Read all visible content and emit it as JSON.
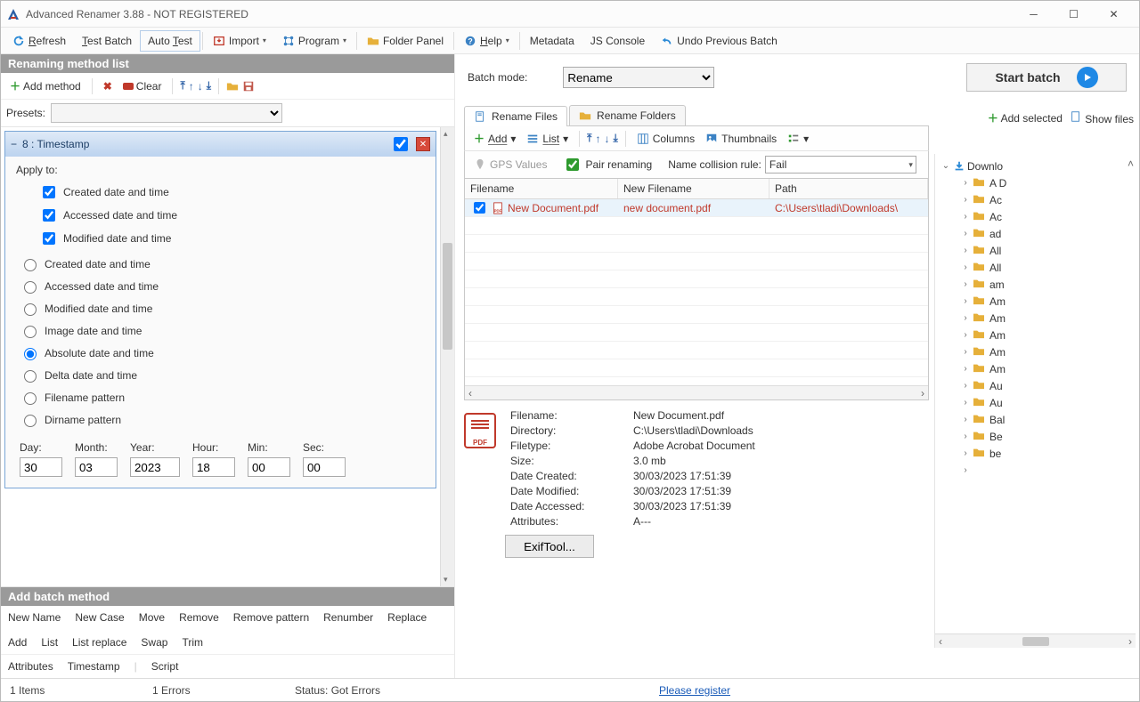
{
  "window": {
    "title": "Advanced Renamer 3.88 - NOT REGISTERED"
  },
  "toolbar": {
    "refresh": "Refresh",
    "test_batch": "Test Batch",
    "auto_test": "Auto Test",
    "import": "Import",
    "program": "Program",
    "folder_panel": "Folder Panel",
    "help": "Help",
    "metadata": "Metadata",
    "js_console": "JS Console",
    "undo": "Undo Previous Batch"
  },
  "left": {
    "header": "Renaming method list",
    "add_method": "Add method",
    "clear": "Clear",
    "presets_label": "Presets:",
    "timestamp_title": "8 : Timestamp",
    "apply_to": "Apply to:",
    "cb_created": "Created date and time",
    "cb_accessed": "Accessed date and time",
    "cb_modified": "Modified date and time",
    "rb_created": "Created date and time",
    "rb_accessed": "Accessed date and time",
    "rb_modified": "Modified date and time",
    "rb_image": "Image date and time",
    "rb_absolute": "Absolute date and time",
    "rb_delta": "Delta date and time",
    "rb_filename": "Filename pattern",
    "rb_dirname": "Dirname pattern",
    "dt": {
      "day_l": "Day:",
      "month_l": "Month:",
      "year_l": "Year:",
      "hour_l": "Hour:",
      "min_l": "Min:",
      "sec_l": "Sec:",
      "day": "30",
      "month": "03",
      "year": "2023",
      "hour": "18",
      "min": "00",
      "sec": "00"
    },
    "add_batch_header": "Add batch method",
    "links1": [
      "New Name",
      "New Case",
      "Move",
      "Remove",
      "Remove pattern",
      "Renumber",
      "Replace",
      "Add",
      "List",
      "List replace",
      "Swap",
      "Trim"
    ],
    "links2": [
      "Attributes",
      "Timestamp",
      "Script"
    ]
  },
  "batch": {
    "label": "Batch mode:",
    "mode": "Rename",
    "start": "Start batch",
    "add_selected": "Add selected",
    "show_files": "Show files"
  },
  "tabs": {
    "files": "Rename Files",
    "folders": "Rename Folders"
  },
  "filetb": {
    "add": "Add",
    "list": "List",
    "columns": "Columns",
    "thumbnails": "Thumbnails",
    "gps": "GPS Values",
    "pair": "Pair renaming",
    "collision_label": "Name collision rule:",
    "collision": "Fail"
  },
  "table": {
    "cols": {
      "filename": "Filename",
      "newfilename": "New Filename",
      "path": "Path"
    },
    "rows": [
      {
        "filename": "New Document.pdf",
        "newfilename": "new document.pdf",
        "path": "C:\\Users\\tladi\\Downloads\\"
      }
    ]
  },
  "details": {
    "labels": {
      "filename": "Filename:",
      "directory": "Directory:",
      "filetype": "Filetype:",
      "size": "Size:",
      "created": "Date Created:",
      "modified": "Date Modified:",
      "accessed": "Date Accessed:",
      "attrs": "Attributes:"
    },
    "values": {
      "filename": "New Document.pdf",
      "directory": "C:\\Users\\tladi\\Downloads",
      "filetype": "Adobe Acrobat Document",
      "size": "3.0 mb",
      "created": "30/03/2023 17:51:39",
      "modified": "30/03/2023 17:51:39",
      "accessed": "30/03/2023 17:51:39",
      "attrs": "A---"
    },
    "exif": "ExifTool..."
  },
  "tree": {
    "root": "Downlo",
    "items": [
      "A D",
      "Ac",
      "Ac",
      "ad",
      "All",
      "All",
      "am",
      "Am",
      "Am",
      "Am",
      "Am",
      "Am",
      "Au",
      "Au",
      "Bal",
      "Be",
      "be"
    ]
  },
  "status": {
    "items": "1 Items",
    "errors": "1 Errors",
    "status": "Status: Got Errors",
    "register": "Please register"
  }
}
